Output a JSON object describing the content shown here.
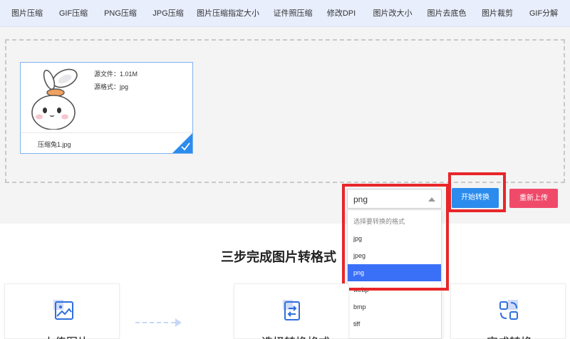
{
  "nav": {
    "items": [
      "图片压缩",
      "GIF压缩",
      "PNG压缩",
      "JPG压缩",
      "图片压缩指定大小",
      "证件照压缩",
      "修改DPI",
      "图片改大小",
      "图片去底色",
      "图片裁剪",
      "GIF分解"
    ]
  },
  "file": {
    "size_text": "源文件：1.01M",
    "format_text": "源格式：jpg",
    "name": "压缩兔1.jpg"
  },
  "format_select": {
    "value": "png",
    "options": [
      {
        "label": "选择要转换的格式",
        "hint": true
      },
      {
        "label": "jpg"
      },
      {
        "label": "jpeg"
      },
      {
        "label": "png",
        "selected": true
      },
      {
        "label": "webp"
      },
      {
        "label": "bmp"
      },
      {
        "label": "tiff"
      }
    ]
  },
  "buttons": {
    "start": "开始转换",
    "reupload": "重新上传"
  },
  "section": {
    "title": "三步完成图片转格式"
  },
  "steps": [
    {
      "label": "上传图片",
      "icon": "image-upload-icon"
    },
    {
      "label": "选择转换格式",
      "icon": "file-convert-icon"
    },
    {
      "label": "完成转换",
      "icon": "convert-complete-icon"
    }
  ],
  "colors": {
    "accent": "#2b8ced",
    "danger": "#f04a6b",
    "nav_bg": "#e8eefc",
    "highlight": "#e8262a",
    "selected": "#3a6ff7"
  }
}
